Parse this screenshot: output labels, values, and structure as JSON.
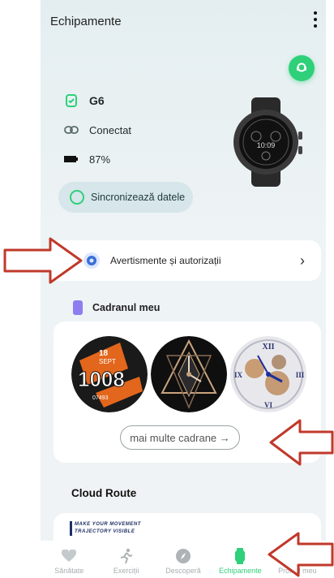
{
  "header": {
    "title": "Echipamente"
  },
  "device": {
    "name": "G6",
    "status": "Conectat",
    "battery": "87%",
    "sync_label": "Sincronizează datele"
  },
  "alerts": {
    "label": "Avertismente și autorizații"
  },
  "faces": {
    "title": "Cadranul meu",
    "more_label": "mai multe cadrane →",
    "face1": {
      "day": "18",
      "month": "SEPT",
      "time": "1008",
      "steps": "07493"
    }
  },
  "cloud": {
    "title": "Cloud Route",
    "banner_line1": "MAKE YOUR MOVEMENT",
    "banner_line2": "TRAJECTORY VISIBLE"
  },
  "tabs": [
    {
      "label": "Sănătate",
      "icon": "heart-icon"
    },
    {
      "label": "Exerciții",
      "icon": "runner-icon"
    },
    {
      "label": "Descoperă",
      "icon": "compass-icon"
    },
    {
      "label": "Echipamente",
      "icon": "watch-icon",
      "active": true
    },
    {
      "label": "Profilul meu",
      "icon": "profile-icon"
    }
  ],
  "colors": {
    "accent": "#2ed07a",
    "annotation_arrow": "#c0392b",
    "background": "#eef3f5"
  }
}
